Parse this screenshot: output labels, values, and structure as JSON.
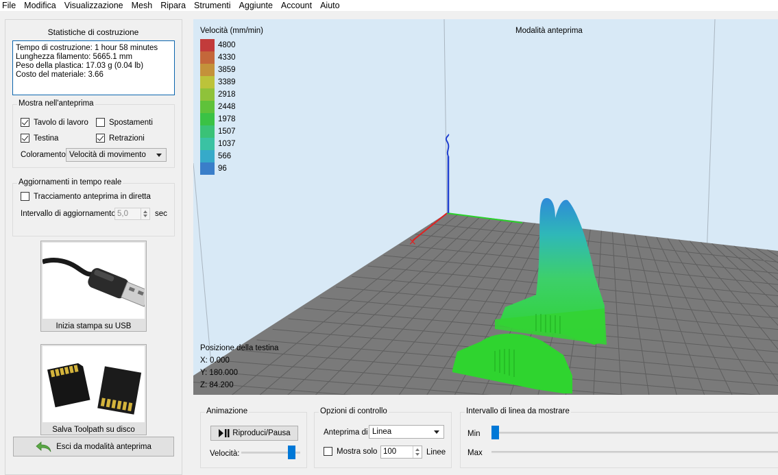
{
  "menu": [
    "File",
    "Modifica",
    "Visualizzazione",
    "Mesh",
    "Ripara",
    "Strumenti",
    "Aggiunte",
    "Account",
    "Aiuto"
  ],
  "stats": {
    "title": "Statistiche di costruzione",
    "lines": [
      "Tempo di costruzione: 1 hour 58 minutes",
      "Lunghezza filamento: 5665.1 mm",
      "Peso della plastica: 17.03 g (0.04 lb)",
      "Costo del materiale: 3.66"
    ]
  },
  "preview": {
    "title": "Mostra nell'anteprima",
    "print_bed": {
      "label": "Tavolo di lavoro",
      "checked": true
    },
    "travel": {
      "label": "Spostamenti",
      "checked": false
    },
    "head": {
      "label": "Testina",
      "checked": true
    },
    "retractions": {
      "label": "Retrazioni",
      "checked": true
    },
    "coloring_label": "Coloramento",
    "coloring_value": "Velocità di movimento"
  },
  "realtime": {
    "title": "Aggiornamenti in tempo reale",
    "live_label": "Tracciamento anteprima in diretta",
    "live_checked": false,
    "interval_label": "Intervallo di aggiornamento",
    "interval_value": "5,0",
    "interval_unit": "sec"
  },
  "usb_button": "Inizia stampa su USB",
  "sd_button": "Salva Toolpath su disco",
  "exit_button": "Esci da modalità anteprima",
  "viewport": {
    "title": "Modalità anteprima",
    "legend_title": "Velocità (mm/min)",
    "legend": [
      {
        "value": "4800",
        "color": "#c23b3b"
      },
      {
        "value": "4330",
        "color": "#c4673a"
      },
      {
        "value": "3859",
        "color": "#c4923a"
      },
      {
        "value": "3389",
        "color": "#bcc33a"
      },
      {
        "value": "2918",
        "color": "#8fc23a"
      },
      {
        "value": "2448",
        "color": "#5fc23a"
      },
      {
        "value": "1978",
        "color": "#3ac245"
      },
      {
        "value": "1507",
        "color": "#3ac277"
      },
      {
        "value": "1037",
        "color": "#3ac2a3"
      },
      {
        "value": "566",
        "color": "#36aac9"
      },
      {
        "value": "96",
        "color": "#3a7ec9"
      }
    ],
    "head_position_title": "Posizione della testina",
    "x": "X: 0.000",
    "y": "Y: 180.000",
    "z": "Z: 84.200"
  },
  "animation": {
    "title": "Animazione",
    "play_label": "Riproduci/Pausa",
    "speed_label": "Velocità:",
    "speed_fraction": 0.9
  },
  "control": {
    "title": "Opzioni di controllo",
    "preview_of_label": "Anteprima di",
    "preview_of_value": "Linea",
    "show_only_label": "Mostra solo",
    "show_only_checked": false,
    "lines_value": "100",
    "lines_unit": "Linee"
  },
  "range": {
    "title": "Intervallo di linea da mostrare",
    "min_label": "Min",
    "max_label": "Max",
    "min_fraction": 0.0
  }
}
